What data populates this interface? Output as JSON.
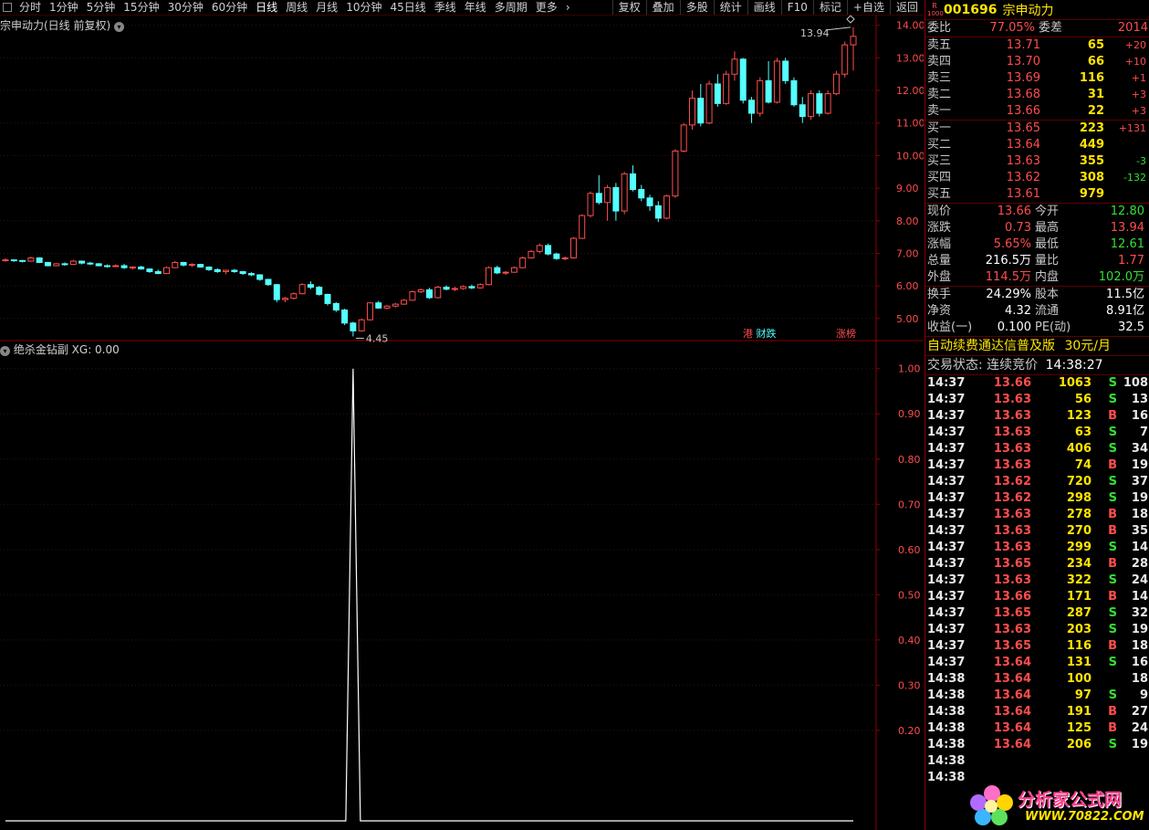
{
  "toolbar": {
    "periods": [
      "分时",
      "1分钟",
      "5分钟",
      "15分钟",
      "30分钟",
      "60分钟",
      "日线",
      "周线",
      "月线",
      "10分钟",
      "45日线",
      "季线",
      "年线",
      "多周期",
      "更多"
    ],
    "active_period": "日线",
    "more_arrow": "›",
    "right_buttons": [
      "复权",
      "叠加",
      "多股",
      "统计",
      "画线",
      "F10",
      "标记",
      "+自选",
      "返回"
    ]
  },
  "main_chart": {
    "title": "宗申动力(日线 前复权)",
    "y_ticks": [
      "14.00",
      "13.00",
      "12.00",
      "11.00",
      "10.00",
      "9.00",
      "8.00",
      "7.00",
      "6.00",
      "5.00"
    ],
    "high_label": "13.94",
    "low_label": "4.45",
    "badges": {
      "gang": "港",
      "caizhang": "财跌",
      "zhangbang": "涨榜"
    }
  },
  "indicator": {
    "title": "绝杀金钻副",
    "value_label": "XG: 0.00",
    "y_ticks": [
      "1.00",
      "0.90",
      "0.80",
      "0.70",
      "0.60",
      "0.50",
      "0.40",
      "0.30",
      "0.20"
    ]
  },
  "chart_data": {
    "type": "candlestick",
    "series": [
      {
        "name": "",
        "ohlc": [
          [
            6.8,
            6.85,
            6.75,
            6.8
          ],
          [
            6.8,
            6.82,
            6.74,
            6.78
          ],
          [
            6.78,
            6.8,
            6.72,
            6.76
          ],
          [
            6.76,
            6.9,
            6.74,
            6.86
          ],
          [
            6.86,
            6.88,
            6.7,
            6.72
          ],
          [
            6.72,
            6.74,
            6.6,
            6.62
          ],
          [
            6.62,
            6.7,
            6.6,
            6.68
          ],
          [
            6.68,
            6.72,
            6.62,
            6.66
          ],
          [
            6.66,
            6.8,
            6.64,
            6.76
          ],
          [
            6.76,
            6.78,
            6.66,
            6.7
          ],
          [
            6.7,
            6.74,
            6.64,
            6.68
          ],
          [
            6.68,
            6.7,
            6.6,
            6.62
          ],
          [
            6.62,
            6.66,
            6.56,
            6.6
          ],
          [
            6.6,
            6.66,
            6.58,
            6.62
          ],
          [
            6.62,
            6.68,
            6.52,
            6.56
          ],
          [
            6.56,
            6.6,
            6.5,
            6.58
          ],
          [
            6.58,
            6.62,
            6.5,
            6.52
          ],
          [
            6.52,
            6.54,
            6.4,
            6.44
          ],
          [
            6.44,
            6.5,
            6.36,
            6.38
          ],
          [
            6.38,
            6.6,
            6.36,
            6.56
          ],
          [
            6.56,
            6.76,
            6.54,
            6.72
          ],
          [
            6.72,
            6.74,
            6.6,
            6.64
          ],
          [
            6.64,
            6.7,
            6.58,
            6.66
          ],
          [
            6.66,
            6.68,
            6.56,
            6.58
          ],
          [
            6.58,
            6.6,
            6.46,
            6.5
          ],
          [
            6.5,
            6.54,
            6.4,
            6.44
          ],
          [
            6.44,
            6.5,
            6.36,
            6.48
          ],
          [
            6.48,
            6.52,
            6.4,
            6.44
          ],
          [
            6.44,
            6.46,
            6.34,
            6.38
          ],
          [
            6.38,
            6.42,
            6.3,
            6.34
          ],
          [
            6.34,
            6.36,
            6.16,
            6.2
          ],
          [
            6.2,
            6.22,
            6.0,
            6.04
          ],
          [
            6.04,
            6.06,
            5.5,
            5.58
          ],
          [
            5.58,
            5.66,
            5.5,
            5.62
          ],
          [
            5.62,
            5.8,
            5.58,
            5.76
          ],
          [
            5.76,
            6.08,
            5.74,
            6.04
          ],
          [
            6.04,
            6.14,
            5.9,
            5.96
          ],
          [
            5.96,
            6.0,
            5.7,
            5.74
          ],
          [
            5.74,
            5.76,
            5.4,
            5.46
          ],
          [
            5.46,
            5.5,
            5.2,
            5.26
          ],
          [
            5.26,
            5.3,
            4.8,
            4.86
          ],
          [
            4.86,
            4.9,
            4.45,
            4.62
          ],
          [
            4.62,
            5.0,
            4.6,
            4.96
          ],
          [
            4.96,
            5.5,
            4.94,
            5.48
          ],
          [
            5.48,
            5.54,
            5.3,
            5.32
          ],
          [
            5.32,
            5.42,
            5.28,
            5.38
          ],
          [
            5.38,
            5.48,
            5.34,
            5.44
          ],
          [
            5.44,
            5.6,
            5.42,
            5.56
          ],
          [
            5.56,
            5.86,
            5.54,
            5.82
          ],
          [
            5.82,
            5.92,
            5.78,
            5.88
          ],
          [
            5.88,
            5.94,
            5.6,
            5.64
          ],
          [
            5.64,
            6.0,
            5.62,
            5.96
          ],
          [
            5.96,
            6.02,
            5.86,
            5.9
          ],
          [
            5.9,
            5.98,
            5.84,
            5.92
          ],
          [
            5.92,
            6.02,
            5.88,
            5.98
          ],
          [
            5.98,
            6.04,
            5.9,
            5.94
          ],
          [
            5.94,
            6.08,
            5.92,
            6.04
          ],
          [
            6.04,
            6.6,
            6.02,
            6.56
          ],
          [
            6.56,
            6.62,
            6.36,
            6.4
          ],
          [
            6.4,
            6.46,
            6.34,
            6.42
          ],
          [
            6.42,
            6.6,
            6.4,
            6.56
          ],
          [
            6.56,
            6.9,
            6.54,
            6.86
          ],
          [
            6.86,
            7.1,
            6.84,
            7.06
          ],
          [
            7.06,
            7.3,
            7.0,
            7.24
          ],
          [
            7.24,
            7.3,
            6.94,
            6.98
          ],
          [
            6.98,
            7.02,
            6.8,
            6.84
          ],
          [
            6.84,
            6.9,
            6.78,
            6.86
          ],
          [
            6.86,
            7.5,
            6.84,
            7.46
          ],
          [
            7.46,
            8.2,
            7.44,
            8.16
          ],
          [
            8.16,
            8.9,
            8.1,
            8.84
          ],
          [
            8.84,
            9.4,
            8.5,
            8.56
          ],
          [
            8.56,
            9.1,
            8.0,
            9.02
          ],
          [
            9.02,
            9.16,
            8.0,
            8.3
          ],
          [
            8.3,
            9.5,
            8.2,
            9.44
          ],
          [
            9.44,
            9.7,
            8.9,
            8.96
          ],
          [
            8.96,
            9.1,
            8.6,
            8.7
          ],
          [
            8.7,
            8.8,
            8.3,
            8.46
          ],
          [
            8.46,
            8.6,
            7.96,
            8.08
          ],
          [
            8.08,
            8.8,
            8.04,
            8.76
          ],
          [
            8.76,
            10.2,
            8.7,
            10.14
          ],
          [
            10.14,
            11.0,
            10.1,
            10.94
          ],
          [
            10.94,
            12.0,
            10.8,
            11.76
          ],
          [
            11.76,
            12.2,
            10.9,
            11.0
          ],
          [
            11.0,
            12.3,
            10.96,
            12.2
          ],
          [
            12.2,
            12.5,
            11.5,
            11.6
          ],
          [
            11.6,
            12.6,
            11.56,
            12.5
          ],
          [
            12.5,
            13.2,
            12.3,
            12.96
          ],
          [
            12.96,
            13.0,
            11.6,
            11.7
          ],
          [
            11.7,
            11.8,
            11.0,
            11.3
          ],
          [
            11.3,
            12.4,
            11.2,
            12.3
          ],
          [
            12.3,
            12.9,
            11.6,
            11.64
          ],
          [
            11.64,
            13.0,
            11.6,
            12.9
          ],
          [
            12.9,
            13.0,
            12.2,
            12.3
          ],
          [
            12.3,
            12.4,
            11.5,
            11.56
          ],
          [
            11.56,
            11.8,
            11.0,
            11.2
          ],
          [
            11.2,
            12.0,
            11.1,
            11.9
          ],
          [
            11.9,
            12.0,
            11.2,
            11.3
          ],
          [
            11.3,
            12.0,
            11.26,
            11.9
          ],
          [
            11.9,
            12.6,
            11.86,
            12.5
          ],
          [
            12.5,
            13.5,
            12.4,
            13.4
          ],
          [
            13.4,
            13.94,
            12.61,
            13.66
          ]
        ]
      }
    ],
    "price_range": [
      4.45,
      13.94
    ],
    "indicator": {
      "name": "XG",
      "spike_index": 41,
      "spike_value": 1.0,
      "baseline": 0.0
    }
  },
  "stock": {
    "r_tag": "R",
    "r_sub": "1000",
    "code": "001696",
    "name": "宗申动力"
  },
  "weibi": {
    "label": "委比",
    "value": "77.05%",
    "label2": "委差",
    "value2": "2014"
  },
  "asks": [
    {
      "label": "卖五",
      "price": "13.71",
      "vol": "65",
      "chg": "+20"
    },
    {
      "label": "卖四",
      "price": "13.70",
      "vol": "66",
      "chg": "+10"
    },
    {
      "label": "卖三",
      "price": "13.69",
      "vol": "116",
      "chg": "+1"
    },
    {
      "label": "卖二",
      "price": "13.68",
      "vol": "31",
      "chg": "+3"
    },
    {
      "label": "卖一",
      "price": "13.66",
      "vol": "22",
      "chg": "+3"
    }
  ],
  "bids": [
    {
      "label": "买一",
      "price": "13.65",
      "vol": "223",
      "chg": "+131",
      "chg_color": "up"
    },
    {
      "label": "买二",
      "price": "13.64",
      "vol": "449",
      "chg": "",
      "chg_color": "up"
    },
    {
      "label": "买三",
      "price": "13.63",
      "vol": "355",
      "chg": "-3",
      "chg_color": "down"
    },
    {
      "label": "买四",
      "price": "13.62",
      "vol": "308",
      "chg": "-132",
      "chg_color": "down"
    },
    {
      "label": "买五",
      "price": "13.61",
      "vol": "979",
      "chg": "",
      "chg_color": "up"
    }
  ],
  "quote": [
    {
      "l1": "现价",
      "v1": "13.66",
      "c1": "up",
      "l2": "今开",
      "v2": "12.80",
      "c2": "down"
    },
    {
      "l1": "涨跌",
      "v1": "0.73",
      "c1": "up",
      "l2": "最高",
      "v2": "13.94",
      "c2": "up"
    },
    {
      "l1": "涨幅",
      "v1": "5.65%",
      "c1": "up",
      "l2": "最低",
      "v2": "12.61",
      "c2": "down"
    },
    {
      "l1": "总量",
      "v1": "216.5万",
      "c1": "white",
      "l2": "量比",
      "v2": "1.77",
      "c2": "up"
    },
    {
      "l1": "外盘",
      "v1": "114.5万",
      "c1": "up",
      "l2": "内盘",
      "v2": "102.0万",
      "c2": "down"
    }
  ],
  "fundamentals": [
    {
      "l1": "换手",
      "v1": "24.29%",
      "l2": "股本",
      "v2": "11.5亿"
    },
    {
      "l1": "净资",
      "v1": "4.32",
      "l2": "流通",
      "v2": "8.91亿"
    },
    {
      "l1": "收益(一)",
      "v1": "0.100",
      "l2": "PE(动)",
      "v2": "32.5"
    }
  ],
  "promo": {
    "text": "自动续费通达信普及版",
    "price": "30元/月"
  },
  "trade_status": {
    "text": "交易状态: 连续竞价",
    "time": "14:38:27"
  },
  "ticks": [
    {
      "t": "14:37",
      "p": "13.66",
      "pc": "up",
      "v": "1063",
      "vc": "purple",
      "bs": "S",
      "n": "108"
    },
    {
      "t": "14:37",
      "p": "13.63",
      "pc": "up",
      "v": "56",
      "vc": "yellow",
      "bs": "S",
      "n": "13"
    },
    {
      "t": "14:37",
      "p": "13.63",
      "pc": "up",
      "v": "123",
      "vc": "yellow",
      "bs": "B",
      "n": "16"
    },
    {
      "t": "14:37",
      "p": "13.63",
      "pc": "up",
      "v": "63",
      "vc": "yellow",
      "bs": "S",
      "n": "7"
    },
    {
      "t": "14:37",
      "p": "13.63",
      "pc": "up",
      "v": "406",
      "vc": "yellow",
      "bs": "S",
      "n": "34"
    },
    {
      "t": "14:37",
      "p": "13.63",
      "pc": "up",
      "v": "74",
      "vc": "yellow",
      "bs": "B",
      "n": "19"
    },
    {
      "t": "14:37",
      "p": "13.62",
      "pc": "up",
      "v": "720",
      "vc": "purple",
      "bs": "S",
      "n": "37"
    },
    {
      "t": "14:37",
      "p": "13.62",
      "pc": "up",
      "v": "298",
      "vc": "yellow",
      "bs": "S",
      "n": "19"
    },
    {
      "t": "14:37",
      "p": "13.63",
      "pc": "up",
      "v": "278",
      "vc": "yellow",
      "bs": "B",
      "n": "18"
    },
    {
      "t": "14:37",
      "p": "13.63",
      "pc": "up",
      "v": "270",
      "vc": "yellow",
      "bs": "B",
      "n": "35"
    },
    {
      "t": "14:37",
      "p": "13.63",
      "pc": "up",
      "v": "299",
      "vc": "yellow",
      "bs": "S",
      "n": "14"
    },
    {
      "t": "14:37",
      "p": "13.65",
      "pc": "up",
      "v": "234",
      "vc": "yellow",
      "bs": "B",
      "n": "28"
    },
    {
      "t": "14:37",
      "p": "13.63",
      "pc": "up",
      "v": "322",
      "vc": "yellow",
      "bs": "S",
      "n": "24"
    },
    {
      "t": "14:37",
      "p": "13.66",
      "pc": "up",
      "v": "171",
      "vc": "yellow",
      "bs": "B",
      "n": "14"
    },
    {
      "t": "14:37",
      "p": "13.65",
      "pc": "up",
      "v": "287",
      "vc": "yellow",
      "bs": "S",
      "n": "32"
    },
    {
      "t": "14:37",
      "p": "13.63",
      "pc": "up",
      "v": "203",
      "vc": "yellow",
      "bs": "S",
      "n": "19"
    },
    {
      "t": "14:37",
      "p": "13.65",
      "pc": "up",
      "v": "116",
      "vc": "yellow",
      "bs": "B",
      "n": "18"
    },
    {
      "t": "14:37",
      "p": "13.64",
      "pc": "up",
      "v": "131",
      "vc": "yellow",
      "bs": "S",
      "n": "16"
    },
    {
      "t": "14:38",
      "p": "13.64",
      "pc": "up",
      "v": "100",
      "vc": "yellow",
      "bs": "",
      "n": "18"
    },
    {
      "t": "14:38",
      "p": "13.64",
      "pc": "up",
      "v": "97",
      "vc": "yellow",
      "bs": "S",
      "n": "9"
    },
    {
      "t": "14:38",
      "p": "13.64",
      "pc": "up",
      "v": "191",
      "vc": "yellow",
      "bs": "B",
      "n": "27"
    },
    {
      "t": "14:38",
      "p": "13.64",
      "pc": "up",
      "v": "125",
      "vc": "yellow",
      "bs": "B",
      "n": "24"
    },
    {
      "t": "14:38",
      "p": "13.64",
      "pc": "up",
      "v": "206",
      "vc": "yellow",
      "bs": "S",
      "n": "19"
    },
    {
      "t": "14:38",
      "p": "",
      "pc": "up",
      "v": "",
      "vc": "yellow",
      "bs": "",
      "n": ""
    },
    {
      "t": "14:38",
      "p": "",
      "pc": "up",
      "v": "",
      "vc": "yellow",
      "bs": "",
      "n": ""
    }
  ],
  "logo": {
    "line1": "分析家公式网",
    "line2": "WWW.70822.COM"
  },
  "colors": {
    "up": "#ff4d4d",
    "down": "#33e033",
    "bull_body": "#000000",
    "bear_body": "#54ffff",
    "axis": "#8b0000"
  }
}
